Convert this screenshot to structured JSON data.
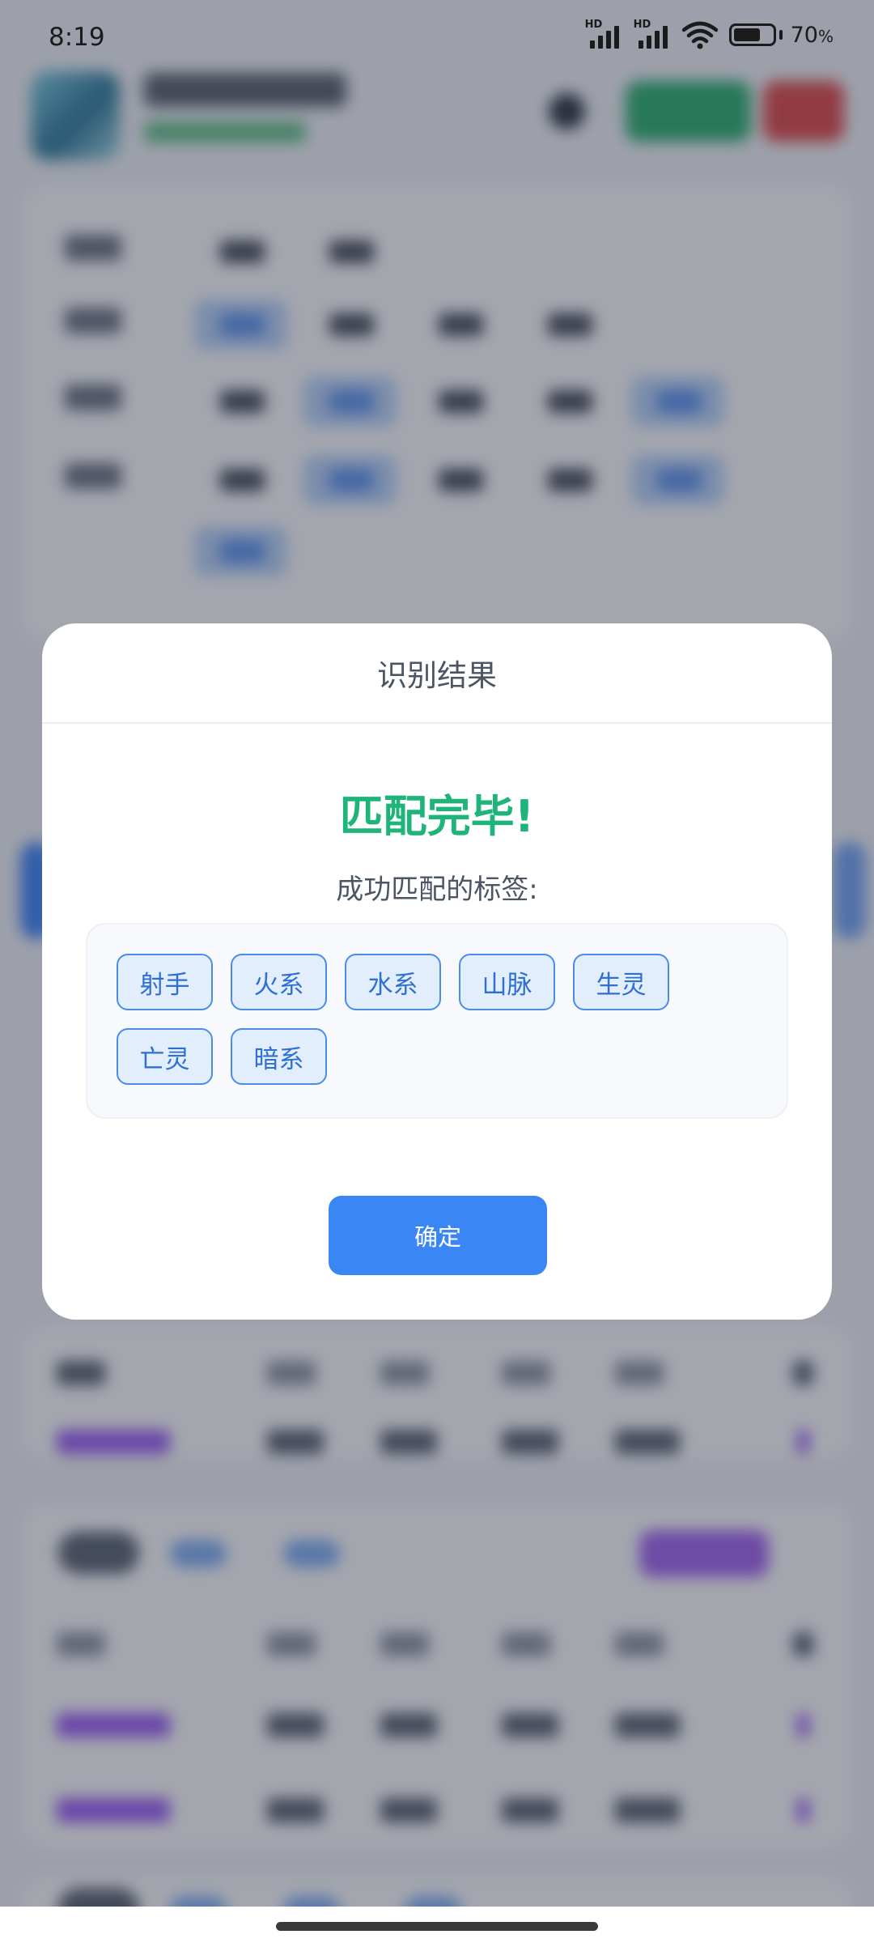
{
  "status_bar": {
    "time": "8:19",
    "signal_1_label": "HD",
    "signal_2_label": "HD",
    "battery_percent": "70",
    "battery_unit": "%",
    "battery_level": 0.7
  },
  "dialog": {
    "title": "识别结果",
    "success_text": "匹配完毕!",
    "subtitle": "成功匹配的标签:",
    "tags": [
      "射手",
      "火系",
      "水系",
      "山脉",
      "生灵",
      "亡灵",
      "暗系"
    ],
    "confirm_label": "确定"
  },
  "colors": {
    "accent_blue": "#3b86f5",
    "success_green": "#1fb57a",
    "tag_border": "#4a8de8",
    "tag_bg": "#e3eefc"
  },
  "icons": {
    "signal": "cellular-signal-icon",
    "wifi": "wifi-icon",
    "battery": "battery-icon"
  }
}
